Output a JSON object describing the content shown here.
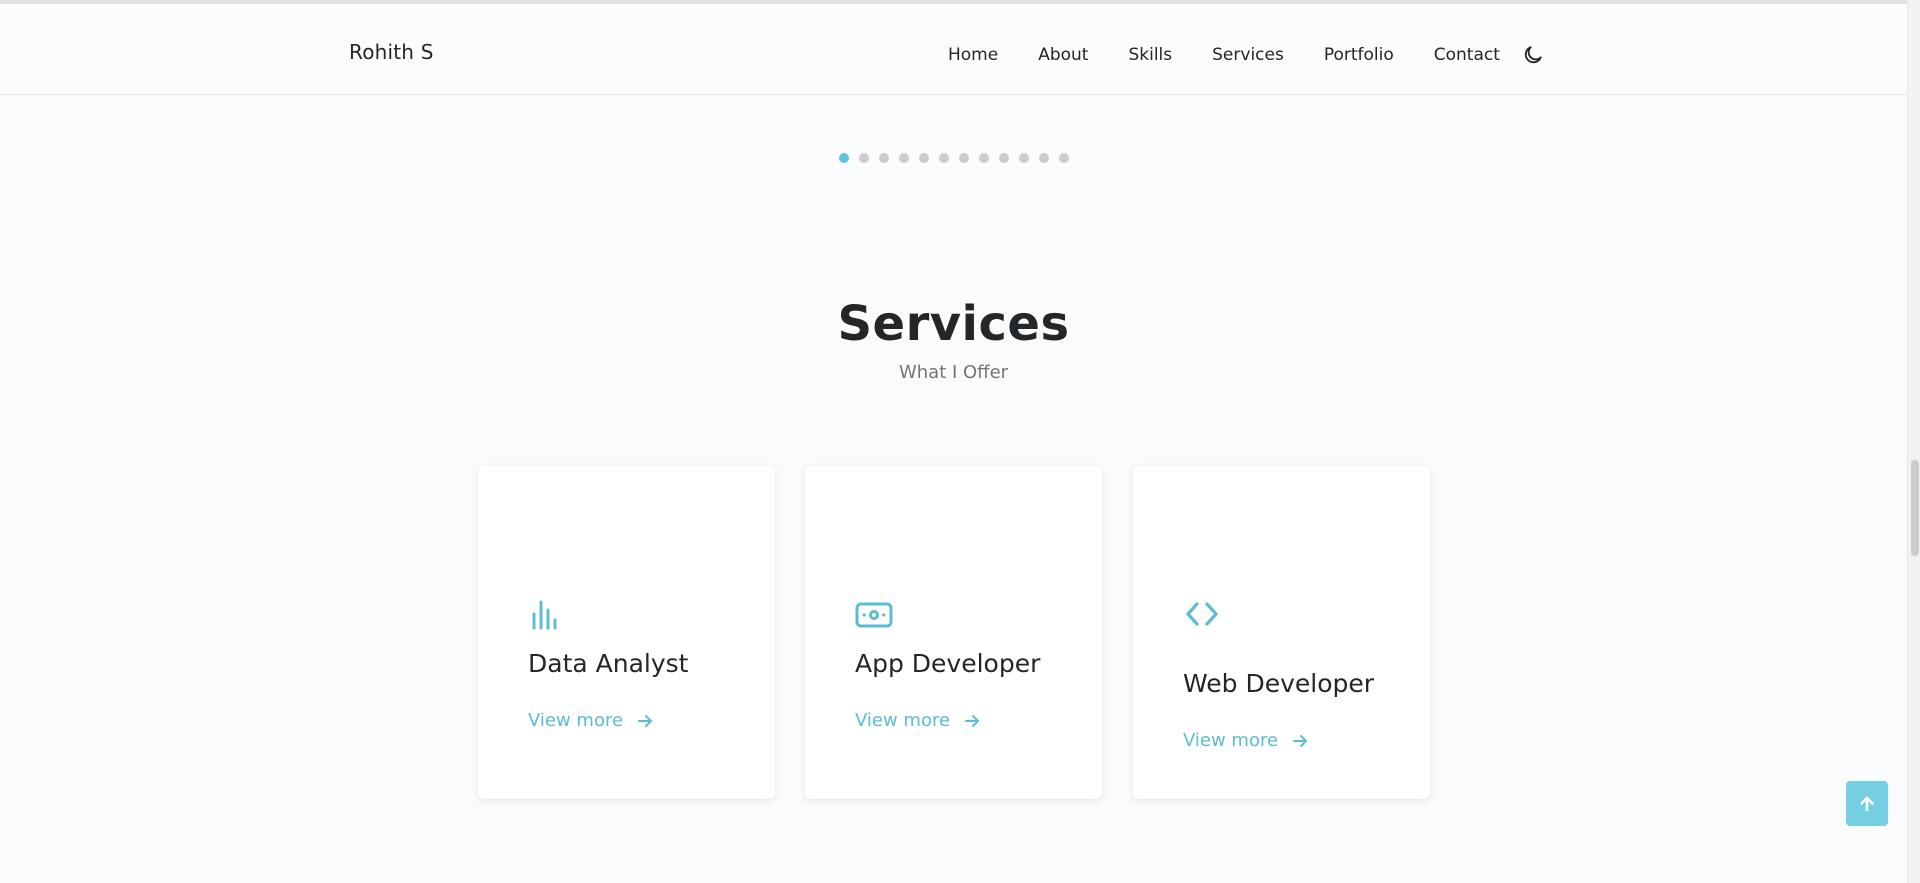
{
  "header": {
    "brand": "Rohith S",
    "nav": [
      {
        "label": "Home"
      },
      {
        "label": "About"
      },
      {
        "label": "Skills"
      },
      {
        "label": "Services"
      },
      {
        "label": "Portfolio"
      },
      {
        "label": "Contact"
      }
    ],
    "theme_toggle_icon": "moon-icon"
  },
  "carousel": {
    "dot_count": 12,
    "active_index": 0,
    "active_color": "#62c2d9",
    "inactive_color": "#c9cccf"
  },
  "services": {
    "title": "Services",
    "subtitle": "What I Offer",
    "cards": [
      {
        "title": "Data Analyst",
        "icon": "bar-chart-icon",
        "link": "View more"
      },
      {
        "title": "App Developer",
        "icon": "money-icon",
        "link": "View more"
      },
      {
        "title": "Web Developer",
        "icon": "code-icon",
        "link": "View more"
      }
    ]
  },
  "colors": {
    "accent": "#5bbcd3",
    "back_to_top": "#75cfe3",
    "background": "#f9fbfd"
  },
  "back_to_top_icon": "arrow-up-icon"
}
